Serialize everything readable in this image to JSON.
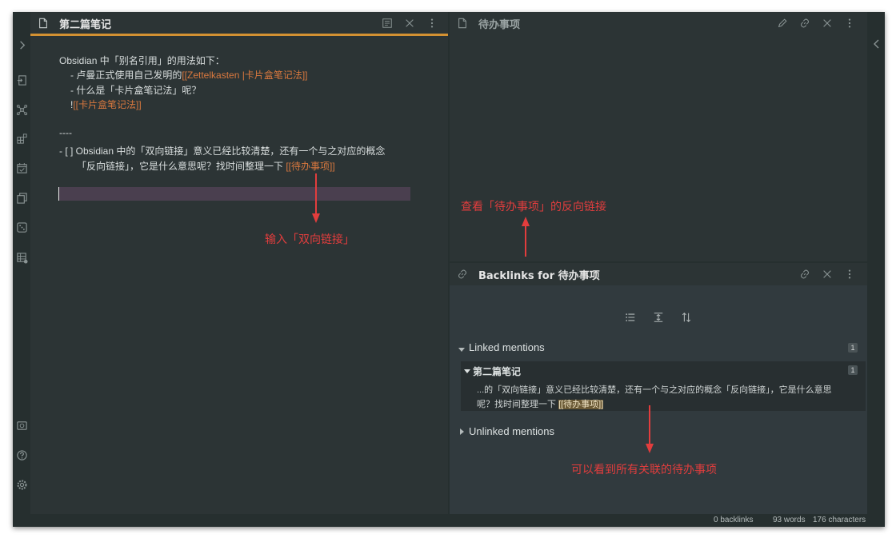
{
  "left_pane": {
    "title": "第二篇笔记",
    "lines": {
      "l1": "Obsidian 中「别名引用」的用法如下：",
      "l2_prefix": "- 卢曼正式使用自己发明的",
      "l2_link": "[[Zettelkasten |卡片盒笔记法]]",
      "l3": "- 什么是「卡片盒笔记法」呢？",
      "l4_prefix": "!",
      "l4_link": "[[卡片盒笔记法]]",
      "l5": "----",
      "l6": "- [ ] Obsidian 中的「双向链接」意义已经比较清楚，还有一个与之对应的概念",
      "l7_prefix": "「反向链接」，它是什么意思呢？找时间整理一下 ",
      "l7_link": "[[待办事项]]"
    }
  },
  "right_top_pane": {
    "title": "待办事项"
  },
  "backlinks_pane": {
    "title": "Backlinks for 待办事项",
    "linked_label": "Linked mentions",
    "linked_count": "1",
    "note_title": "第二篇笔记",
    "note_count": "1",
    "snippet_line1": "...的「双向链接」意义已经比较清楚，还有一个与之对应的概念「反向链接」，它是什么意思",
    "snippet_line2_prefix": "呢？找时间整理一下 ",
    "snippet_highlight": "[[待办事项]]",
    "unlinked_label": "Unlinked mentions"
  },
  "annotations": {
    "input_bidirectional": "输入「双向链接」",
    "view_backlinks": "查看「待办事项」的反向链接",
    "see_all": "可以看到所有关联的待办事项"
  },
  "status_bar": {
    "backlinks": "0 backlinks",
    "words": "93 words",
    "characters": "176 characters"
  },
  "colors": {
    "accent": "#d39132",
    "link": "#d9783e",
    "annotation": "#e23d3d",
    "cursor_line": "#4a3f4f",
    "highlight": "#6b5a36"
  },
  "icons": [
    "chevron-right-icon",
    "file-open-icon",
    "graph-icon",
    "plugins-icon",
    "calendar-icon",
    "copy-icon",
    "dice-icon",
    "table-icon",
    "vault-icon",
    "help-icon",
    "settings-icon",
    "file-icon",
    "reading-view-icon",
    "close-icon",
    "more-options-icon",
    "edit-icon",
    "link-icon",
    "list-icon",
    "collapse-icon",
    "sort-icon",
    "chevron-left-icon"
  ]
}
